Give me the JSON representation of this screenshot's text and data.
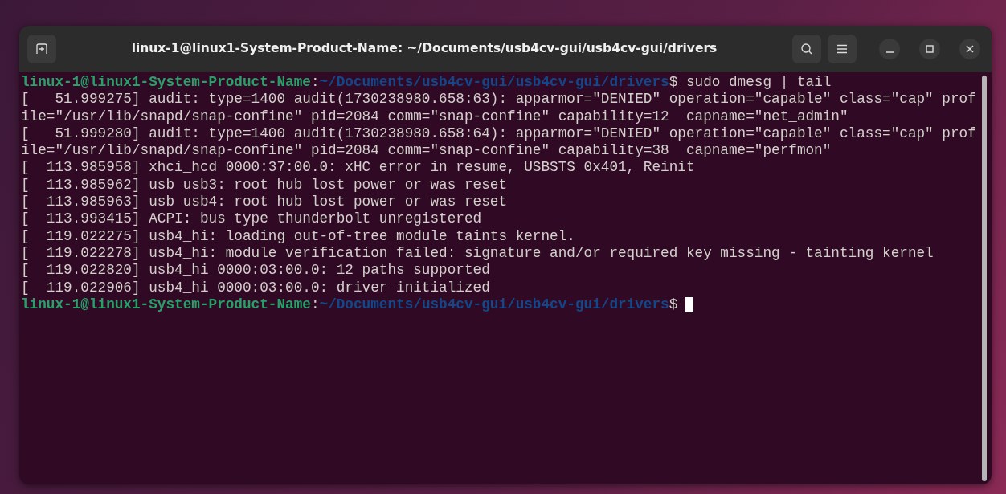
{
  "window": {
    "title": "linux-1@linux1-System-Product-Name: ~/Documents/usb4cv-gui/usb4cv-gui/drivers"
  },
  "terminal": {
    "lines": [
      {
        "kind": "prompt",
        "user_host": "linux-1@linux1-System-Product-Name",
        "colon": ":",
        "path": "~/Documents/usb4cv-gui/usb4cv-gui/drivers",
        "command": "$ sudo dmesg | tail",
        "cursor": false
      },
      {
        "kind": "output",
        "text": "[   51.999275] audit: type=1400 audit(1730238980.658:63): apparmor=\"DENIED\" operation=\"capable\" class=\"cap\" prof"
      },
      {
        "kind": "output",
        "text": "ile=\"/usr/lib/snapd/snap-confine\" pid=2084 comm=\"snap-confine\" capability=12  capname=\"net_admin\""
      },
      {
        "kind": "output",
        "text": "[   51.999280] audit: type=1400 audit(1730238980.658:64): apparmor=\"DENIED\" operation=\"capable\" class=\"cap\" prof"
      },
      {
        "kind": "output",
        "text": "ile=\"/usr/lib/snapd/snap-confine\" pid=2084 comm=\"snap-confine\" capability=38  capname=\"perfmon\""
      },
      {
        "kind": "output",
        "text": "[  113.985958] xhci_hcd 0000:37:00.0: xHC error in resume, USBSTS 0x401, Reinit"
      },
      {
        "kind": "output",
        "text": "[  113.985962] usb usb3: root hub lost power or was reset"
      },
      {
        "kind": "output",
        "text": "[  113.985963] usb usb4: root hub lost power or was reset"
      },
      {
        "kind": "output",
        "text": "[  113.993415] ACPI: bus type thunderbolt unregistered"
      },
      {
        "kind": "output",
        "text": "[  119.022275] usb4_hi: loading out-of-tree module taints kernel."
      },
      {
        "kind": "output",
        "text": "[  119.022278] usb4_hi: module verification failed: signature and/or required key missing - tainting kernel"
      },
      {
        "kind": "output",
        "text": "[  119.022820] usb4_hi 0000:03:00.0: 12 paths supported"
      },
      {
        "kind": "output",
        "text": "[  119.022906] usb4_hi 0000:03:00.0: driver initialized"
      },
      {
        "kind": "prompt",
        "user_host": "linux-1@linux1-System-Product-Name",
        "colon": ":",
        "path": "~/Documents/usb4cv-gui/usb4cv-gui/drivers",
        "command": "$",
        "cursor": true
      }
    ]
  }
}
